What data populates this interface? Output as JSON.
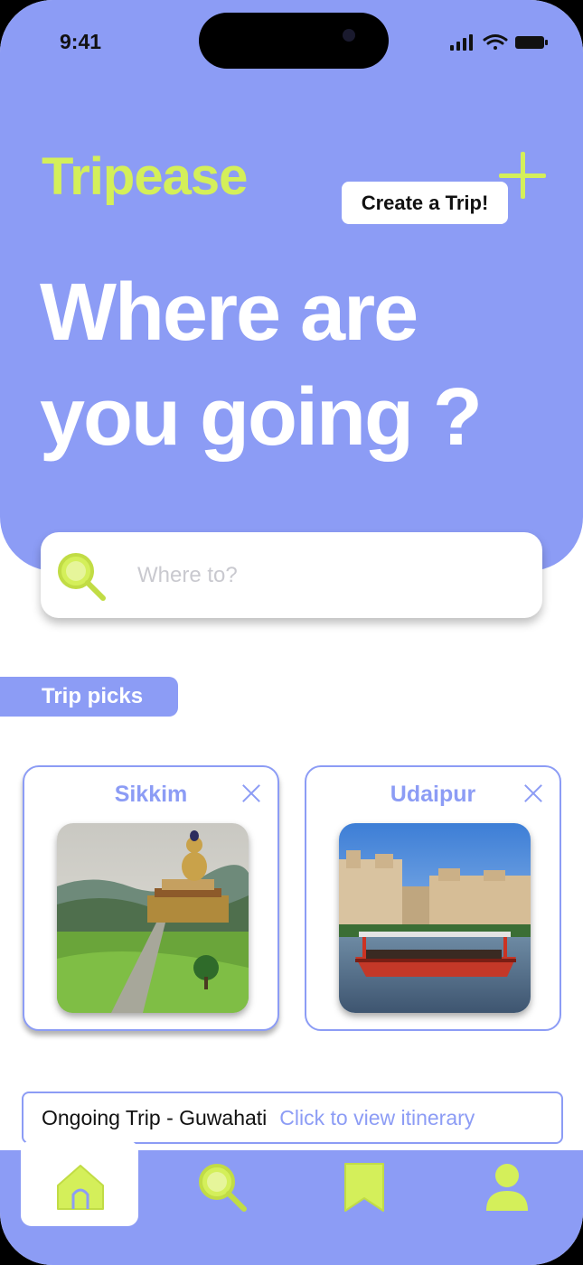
{
  "status_bar": {
    "time": "9:41"
  },
  "header": {
    "logo_text": "Tripease",
    "create_trip_label": "Create a Trip!",
    "headline_line1": "Where are",
    "headline_line2": "you going ?"
  },
  "search": {
    "placeholder": "Where to?"
  },
  "trip_picks": {
    "label": "Trip picks",
    "cards": [
      {
        "title": "Sikkim"
      },
      {
        "title": "Udaipur"
      }
    ]
  },
  "ongoing_trip": {
    "title": "Ongoing Trip - Guwahati",
    "link_text": "Click to view itinerary"
  },
  "bottom_nav": {
    "items": [
      "home-icon",
      "search-icon",
      "bookmark-icon",
      "profile-icon"
    ],
    "active": "home-icon"
  },
  "colors": {
    "primary": "#8c9cf5",
    "accent": "#d4ef5a",
    "background": "#ffffff"
  }
}
